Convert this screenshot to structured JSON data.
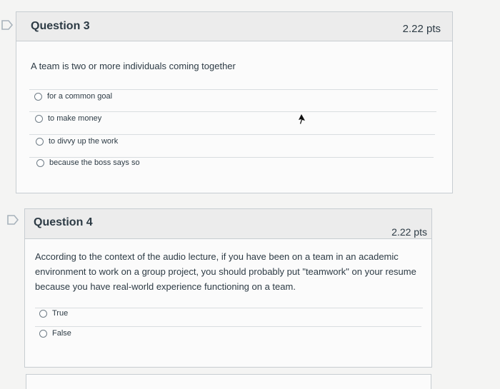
{
  "questions": [
    {
      "title": "Question 3",
      "points": "2.22 pts",
      "text": "A team is two or more individuals coming together",
      "answers": [
        "for a common goal",
        "to make money",
        "to divvy up the work",
        "because the boss says so"
      ]
    },
    {
      "title": "Question 4",
      "points": "2.22 pts",
      "text_lines": [
        "According to the context of the audio lecture, if you have been on a team in an academic",
        "environment to work on a group project, you should probably put \"teamwork\" on your resume",
        "because you have real-world experience functioning on a team."
      ],
      "answers": [
        "True",
        "False"
      ]
    }
  ],
  "colors": {
    "flag": "#a7b2bb",
    "card_header": "#ececec",
    "border": "#c7cdd1"
  },
  "icons": [
    "bookmark-flag-icon",
    "mouse-cursor-icon"
  ]
}
